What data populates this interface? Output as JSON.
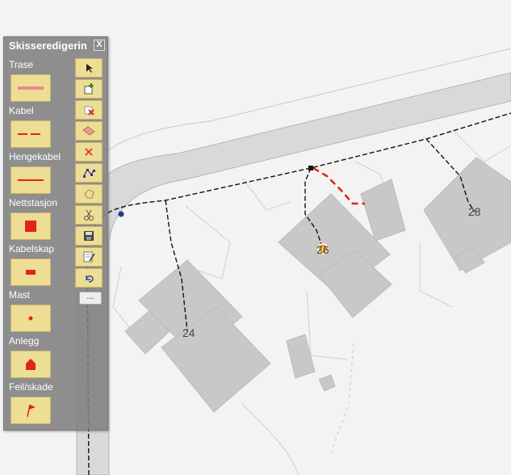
{
  "panel": {
    "title": "Skisseredigerin",
    "close_label": "X",
    "more_label": "...",
    "tools": [
      {
        "label": "Trase",
        "icon": "trase-line-icon"
      },
      {
        "label": "Kabel",
        "icon": "kabel-dashed-icon"
      },
      {
        "label": "Hengekabel",
        "icon": "hengekabel-line-icon"
      },
      {
        "label": "Nettstasjon",
        "icon": "nettstasjon-square-icon"
      },
      {
        "label": "Kabelskap",
        "icon": "kabelskap-rect-icon"
      },
      {
        "label": "Mast",
        "icon": "mast-dot-icon"
      },
      {
        "label": "Anlegg",
        "icon": "anlegg-house-icon"
      },
      {
        "label": "Feil/skade",
        "icon": "feil-flag-icon"
      }
    ],
    "side_tools": [
      "select-arrow-icon",
      "add-sketch-icon",
      "delete-sketch-icon",
      "eraser-icon",
      "delete-x-icon",
      "edit-vertices-icon",
      "rotate-icon",
      "cut-icon",
      "save-icon",
      "edit-note-icon",
      "undo-icon"
    ]
  },
  "map": {
    "house_numbers": [
      "24",
      "26",
      "28"
    ]
  },
  "colors": {
    "panel_bg": "#808080",
    "button_bg": "#eedd94",
    "accent_red": "#e2231a",
    "cable_black": "#111111",
    "building": "#c8c8c8"
  }
}
